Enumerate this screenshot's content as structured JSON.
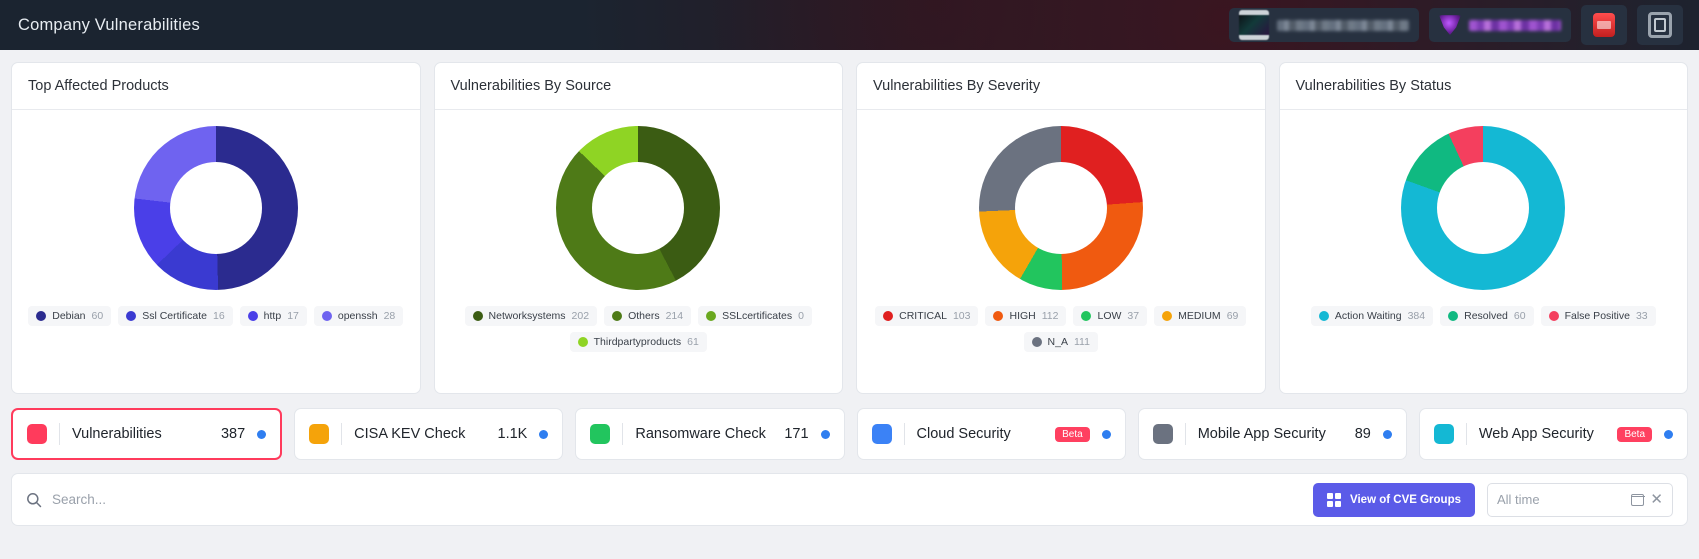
{
  "header": {
    "title": "Company Vulnerabilities",
    "chips": [
      {
        "name": "account-chip",
        "redacted": true
      },
      {
        "name": "tenant-chip",
        "redacted": true
      }
    ],
    "icons": [
      "notification-icon",
      "apps-icon"
    ]
  },
  "cards": [
    {
      "title": "Top Affected Products",
      "chart_data": {
        "type": "pie",
        "title": "Top Affected Products",
        "labels": [
          "Debian",
          "Ssl Certificate",
          "http",
          "openssh"
        ],
        "values": [
          60,
          16,
          17,
          28
        ],
        "colors": [
          "#2b2b8f",
          "#3a3ad1",
          "#4a3fe8",
          "#6f63f0"
        ],
        "legend": "bottom"
      }
    },
    {
      "title": "Vulnerabilities By Source",
      "chart_data": {
        "type": "pie",
        "title": "Vulnerabilities By Source",
        "labels": [
          "Networksystems",
          "Others",
          "SSLcertificates",
          "Thirdpartyproducts"
        ],
        "values": [
          202,
          214,
          0,
          61
        ],
        "colors": [
          "#3b5c13",
          "#4e7a17",
          "#6aa81f",
          "#8fd424"
        ],
        "legend": "bottom"
      }
    },
    {
      "title": "Vulnerabilities By Severity",
      "chart_data": {
        "type": "pie",
        "title": "Vulnerabilities By Severity",
        "labels": [
          "CRITICAL",
          "HIGH",
          "LOW",
          "MEDIUM",
          "N_A"
        ],
        "values": [
          103,
          112,
          37,
          69,
          111
        ],
        "colors": [
          "#e02020",
          "#f05a10",
          "#22c55e",
          "#f5a30a",
          "#6b7280"
        ],
        "legend": "bottom"
      }
    },
    {
      "title": "Vulnerabilities By Status",
      "chart_data": {
        "type": "pie",
        "title": "Vulnerabilities By Status",
        "labels": [
          "Action Waiting",
          "Resolved",
          "False Positive"
        ],
        "values": [
          384,
          60,
          33
        ],
        "colors": [
          "#14b8d4",
          "#10b981",
          "#f43f5e"
        ],
        "legend": "bottom"
      }
    }
  ],
  "tabs": [
    {
      "label": "Vulnerabilities",
      "count": "387",
      "color": "#ff3b5c",
      "active": true,
      "info": true,
      "beta": null
    },
    {
      "label": "CISA KEV Check",
      "count": "1.1K",
      "color": "#f5a30a",
      "active": false,
      "info": true,
      "beta": null
    },
    {
      "label": "Ransomware Check",
      "count": "171",
      "color": "#22c55e",
      "active": false,
      "info": true,
      "beta": null
    },
    {
      "label": "Cloud Security",
      "count": "",
      "color": "#3b82f6",
      "active": false,
      "info": true,
      "beta": "Beta"
    },
    {
      "label": "Mobile App Security",
      "count": "89",
      "color": "#6b7280",
      "active": false,
      "info": true,
      "beta": null
    },
    {
      "label": "Web App Security",
      "count": "",
      "color": "#14b8d4",
      "active": false,
      "info": true,
      "beta": "Beta"
    }
  ],
  "toolbar": {
    "search_placeholder": "Search...",
    "cve_button_label": "View of CVE Groups",
    "date_value": "All time"
  }
}
